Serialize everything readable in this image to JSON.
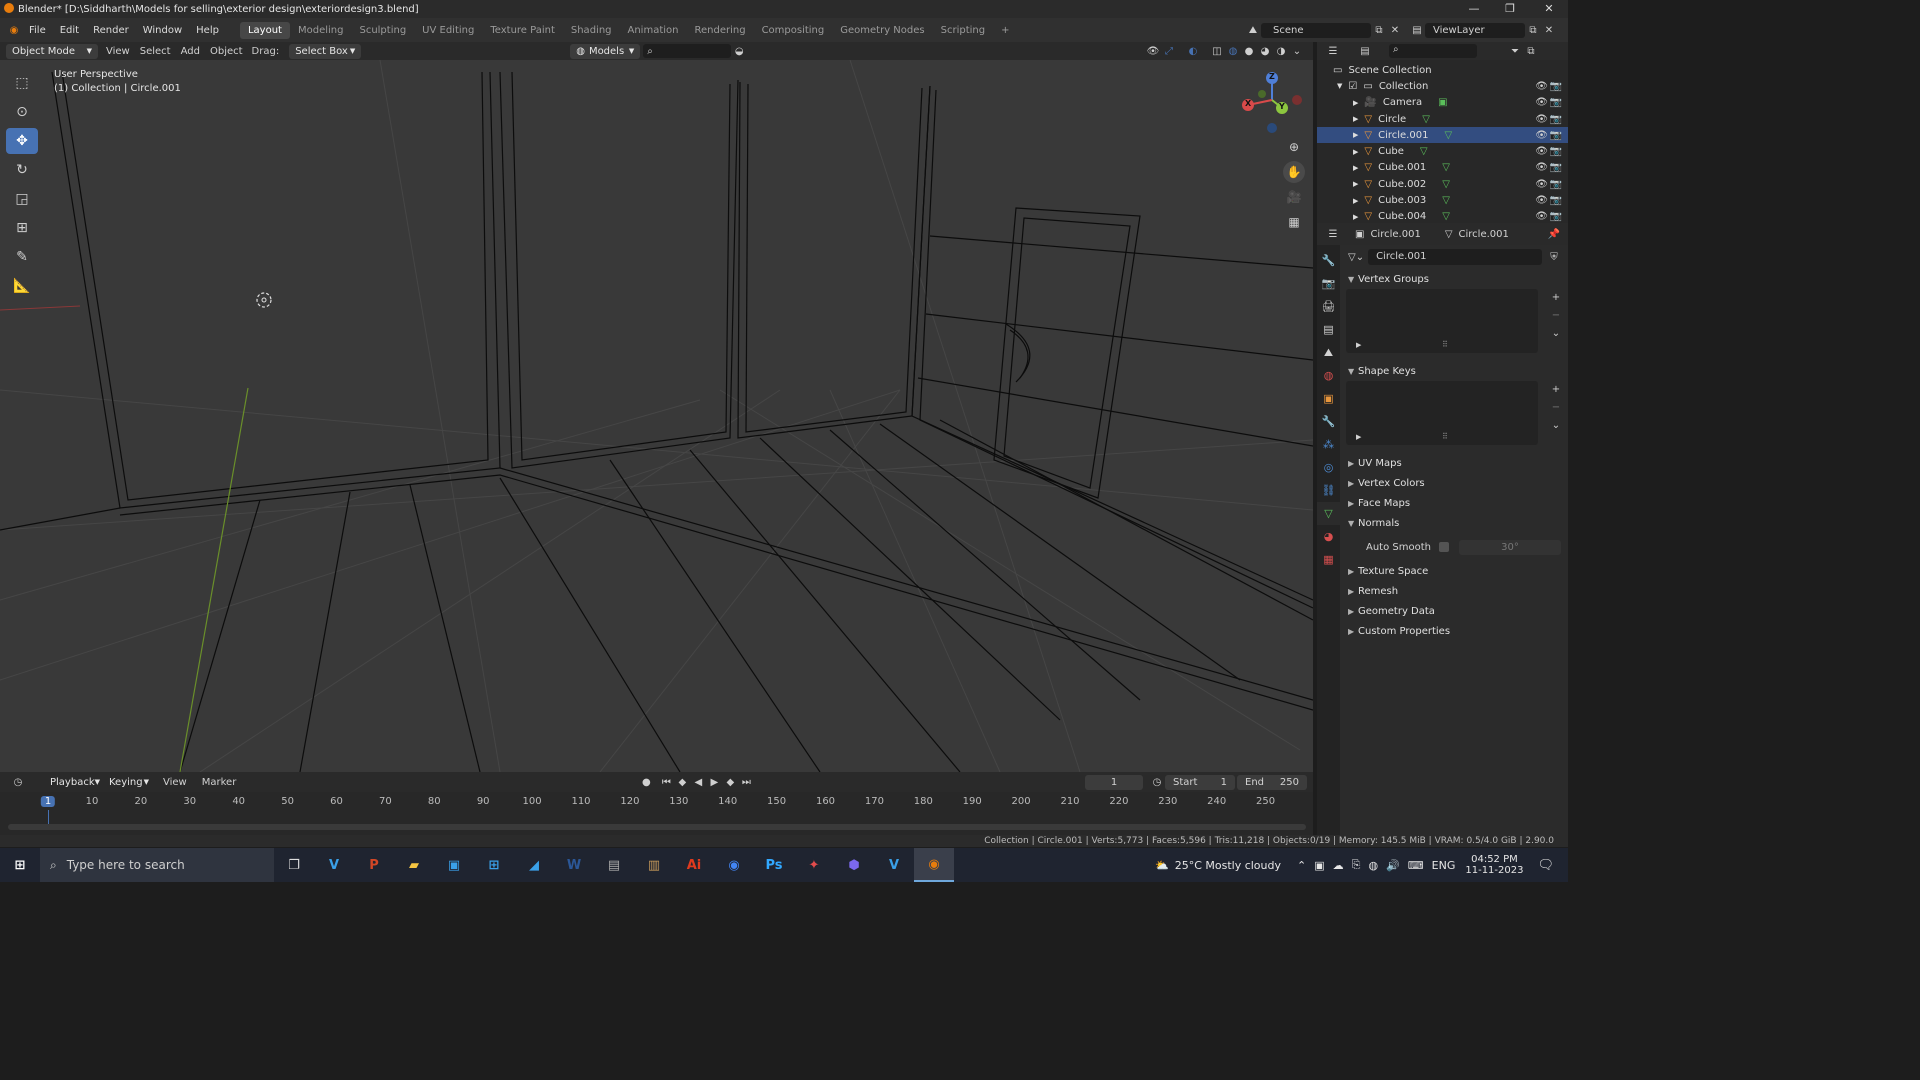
{
  "titlebar": {
    "title": "Blender* [D:\\Siddharth\\Models for selling\\exterior design\\exteriordesign3.blend]",
    "minimize": "—",
    "maximize": "❐",
    "close": "✕"
  },
  "menu": {
    "items": [
      "File",
      "Edit",
      "Render",
      "Window",
      "Help"
    ]
  },
  "workspaces": {
    "tabs": [
      "Layout",
      "Modeling",
      "Sculpting",
      "UV Editing",
      "Texture Paint",
      "Shading",
      "Animation",
      "Rendering",
      "Compositing",
      "Geometry Nodes",
      "Scripting"
    ],
    "active": "Layout",
    "add": "+"
  },
  "scene": {
    "label": "Scene",
    "viewlayer": "ViewLayer"
  },
  "viewport_header": {
    "mode": "Object Mode",
    "view": "View",
    "select": "Select",
    "add": "Add",
    "object": "Object",
    "drag_label": "Drag:",
    "drag_value": "Select Box",
    "orientation": "Models"
  },
  "viewport": {
    "title": "User Perspective",
    "subtitle": "(1) Collection | Circle.001"
  },
  "gizmo": {
    "x": "X",
    "y": "Y",
    "z": "Z"
  },
  "outliner": {
    "root": "Scene Collection",
    "collection": "Collection",
    "items": [
      {
        "name": "Camera",
        "icon": "camera-icon"
      },
      {
        "name": "Circle",
        "icon": "mesh-icon"
      },
      {
        "name": "Circle.001",
        "icon": "mesh-icon"
      },
      {
        "name": "Cube",
        "icon": "mesh-icon"
      },
      {
        "name": "Cube.001",
        "icon": "mesh-icon"
      },
      {
        "name": "Cube.002",
        "icon": "mesh-icon"
      },
      {
        "name": "Cube.003",
        "icon": "mesh-icon"
      },
      {
        "name": "Cube.004",
        "icon": "mesh-icon"
      }
    ]
  },
  "properties": {
    "object_name": "Circle.001",
    "mesh_name": "Circle.001",
    "data_field": "Circle.001",
    "sections": {
      "vertex_groups": "Vertex Groups",
      "shape_keys": "Shape Keys",
      "uv_maps": "UV Maps",
      "vertex_colors": "Vertex Colors",
      "face_maps": "Face Maps",
      "normals": "Normals",
      "texture_space": "Texture Space",
      "remesh": "Remesh",
      "geometry_data": "Geometry Data",
      "custom_properties": "Custom Properties"
    },
    "auto_smooth_label": "Auto Smooth",
    "auto_smooth_angle": "30°"
  },
  "timeline": {
    "playback": "Playback",
    "keying": "Keying",
    "view": "View",
    "marker": "Marker",
    "current_frame": "1",
    "start_label": "Start",
    "start": "1",
    "end_label": "End",
    "end": "250",
    "ticks": [
      "1",
      "10",
      "20",
      "30",
      "40",
      "50",
      "60",
      "70",
      "80",
      "90",
      "100",
      "110",
      "120",
      "130",
      "140",
      "150",
      "160",
      "170",
      "180",
      "190",
      "200",
      "210",
      "220",
      "230",
      "240",
      "250"
    ]
  },
  "statusbar": {
    "text": "Collection | Circle.001 | Verts:5,773 | Faces:5,596 | Tris:11,218 | Objects:0/19 | Memory: 145.5 MiB | VRAM: 0.5/4.0 GiB | 2.90.0"
  },
  "taskbar": {
    "search_placeholder": "Type here to search",
    "weather": "25°C  Mostly cloudy",
    "lang": "ENG",
    "time": "04:52 PM",
    "date": "11-11-2023"
  },
  "colors": {
    "accent": "#4772b3",
    "active_tab": "#474747",
    "viewport_bg": "#393939",
    "frame_marker": "#4772b3"
  }
}
